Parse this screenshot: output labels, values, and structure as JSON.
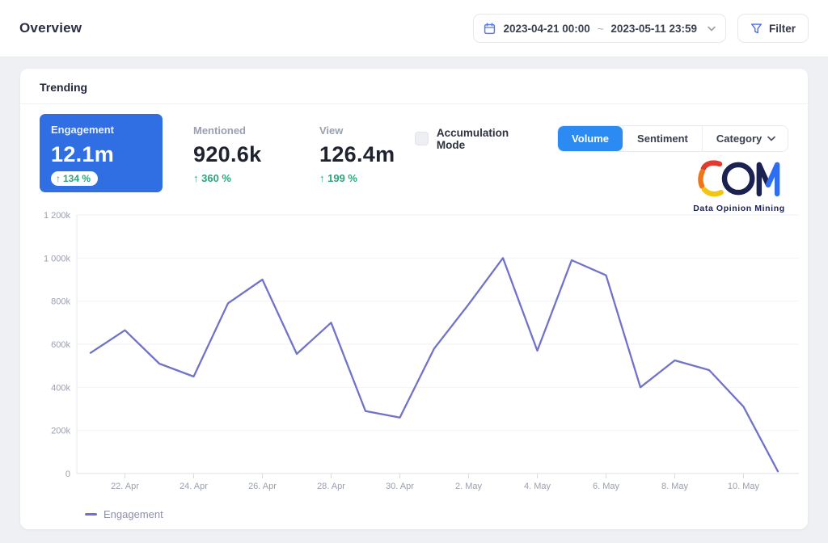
{
  "topbar": {
    "title": "Overview",
    "date_range": {
      "start": "2023-04-21 00:00",
      "separator": "~",
      "end": "2023-05-11 23:59"
    },
    "filter_label": "Filter"
  },
  "card": {
    "title": "Trending",
    "metrics": [
      {
        "label": "Engagement",
        "value": "12.1m",
        "change_arrow": "↑",
        "change": "134 %",
        "selected": true
      },
      {
        "label": "Mentioned",
        "value": "920.6k",
        "change_arrow": "↑",
        "change": "360 %",
        "selected": false
      },
      {
        "label": "View",
        "value": "126.4m",
        "change_arrow": "↑",
        "change": "199 %",
        "selected": false
      }
    ],
    "accumulation_label": "Accumulation Mode",
    "view_tabs": [
      {
        "label": "Volume",
        "active": true
      },
      {
        "label": "Sentiment",
        "active": false
      },
      {
        "label": "Category",
        "active": false,
        "has_dropdown": true
      }
    ]
  },
  "logo": {
    "name": "DOM",
    "subtitle": "Data Opinion Mining"
  },
  "chart_data": {
    "type": "line",
    "title": "Trending",
    "unit": "thousands",
    "ylim": [
      0,
      1200
    ],
    "grid": "horizontal-only",
    "legend_position": "bottom-left",
    "y_ticks": [
      {
        "value": 1200,
        "label": "1 200k"
      },
      {
        "value": 1000,
        "label": "1 000k"
      },
      {
        "value": 800,
        "label": "800k"
      },
      {
        "value": 600,
        "label": "600k"
      },
      {
        "value": 400,
        "label": "400k"
      },
      {
        "value": 200,
        "label": "200k"
      },
      {
        "value": 0,
        "label": "0"
      }
    ],
    "x": [
      "2023-04-21",
      "2023-04-22",
      "2023-04-23",
      "2023-04-24",
      "2023-04-25",
      "2023-04-26",
      "2023-04-27",
      "2023-04-28",
      "2023-04-29",
      "2023-04-30",
      "2023-05-01",
      "2023-05-02",
      "2023-05-03",
      "2023-05-04",
      "2023-05-05",
      "2023-05-06",
      "2023-05-07",
      "2023-05-08",
      "2023-05-09",
      "2023-05-10",
      "2023-05-11"
    ],
    "x_tick_labels": [
      "22. Apr",
      "24. Apr",
      "26. Apr",
      "28. Apr",
      "30. Apr",
      "2. May",
      "4. May",
      "6. May",
      "8. May",
      "10. May"
    ],
    "x_tick_indices": [
      1,
      3,
      5,
      7,
      9,
      11,
      13,
      15,
      17,
      19
    ],
    "series": [
      {
        "name": "Engagement",
        "color": "#7173c8",
        "values": [
          560,
          665,
          510,
          450,
          790,
          900,
          555,
          700,
          290,
          260,
          580,
          785,
          1000,
          570,
          990,
          920,
          400,
          525,
          480,
          310,
          10
        ]
      }
    ]
  },
  "legend": {
    "label": "Engagement"
  },
  "colors": {
    "accent_blue": "#2f6fe3",
    "tab_blue": "#2b8bf2",
    "positive_green": "#2aa779",
    "line_purple": "#7173c8",
    "icon_blue": "#5b7ce8"
  }
}
